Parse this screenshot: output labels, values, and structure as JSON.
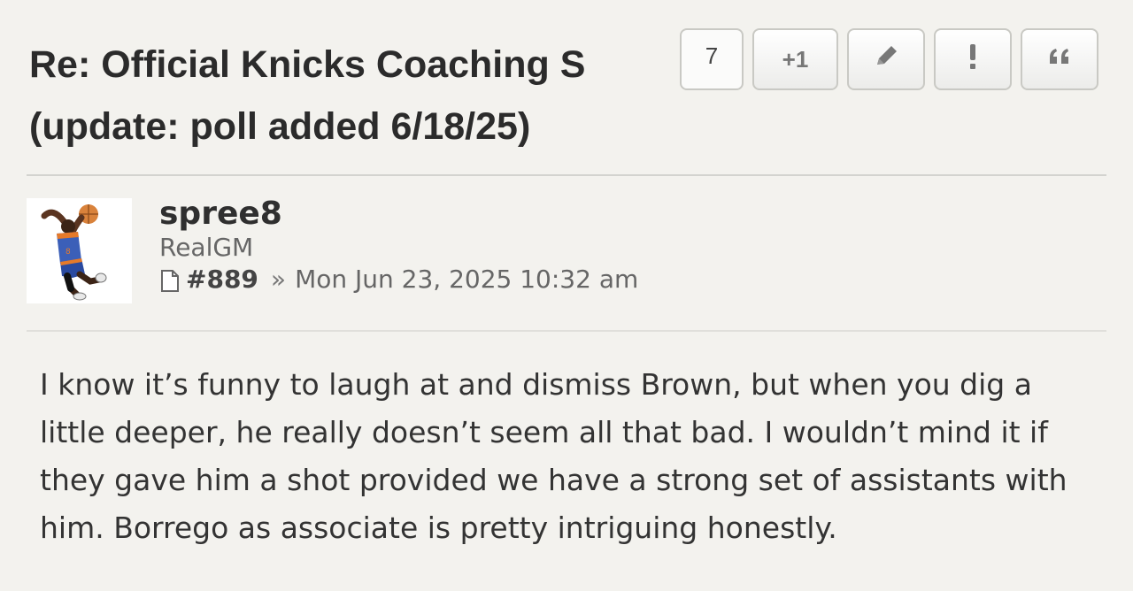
{
  "post": {
    "title_line1": "Re: Official Knicks Coaching S",
    "title_line2": "(update: poll added 6/18/25)"
  },
  "actions": {
    "count": "7",
    "plus_one": "+1",
    "edit_icon": "pencil-icon",
    "report_icon": "exclamation-icon",
    "quote_icon": "quote-icon"
  },
  "author": {
    "username": "spree8",
    "rank": "RealGM",
    "avatar_icon": "basketball-dunk-avatar"
  },
  "meta": {
    "post_number": "#889",
    "separator": "»",
    "timestamp": "Mon Jun 23, 2025 10:32 am"
  },
  "body": {
    "text": "I know it’s funny to laugh at and dismiss Brown, but when you dig a little deeper, he really doesn’t seem all that bad. I wouldn’t mind it if they gave him a shot provided we have a strong set of assistants with him. Borrego as associate is pretty intriguing honestly."
  }
}
